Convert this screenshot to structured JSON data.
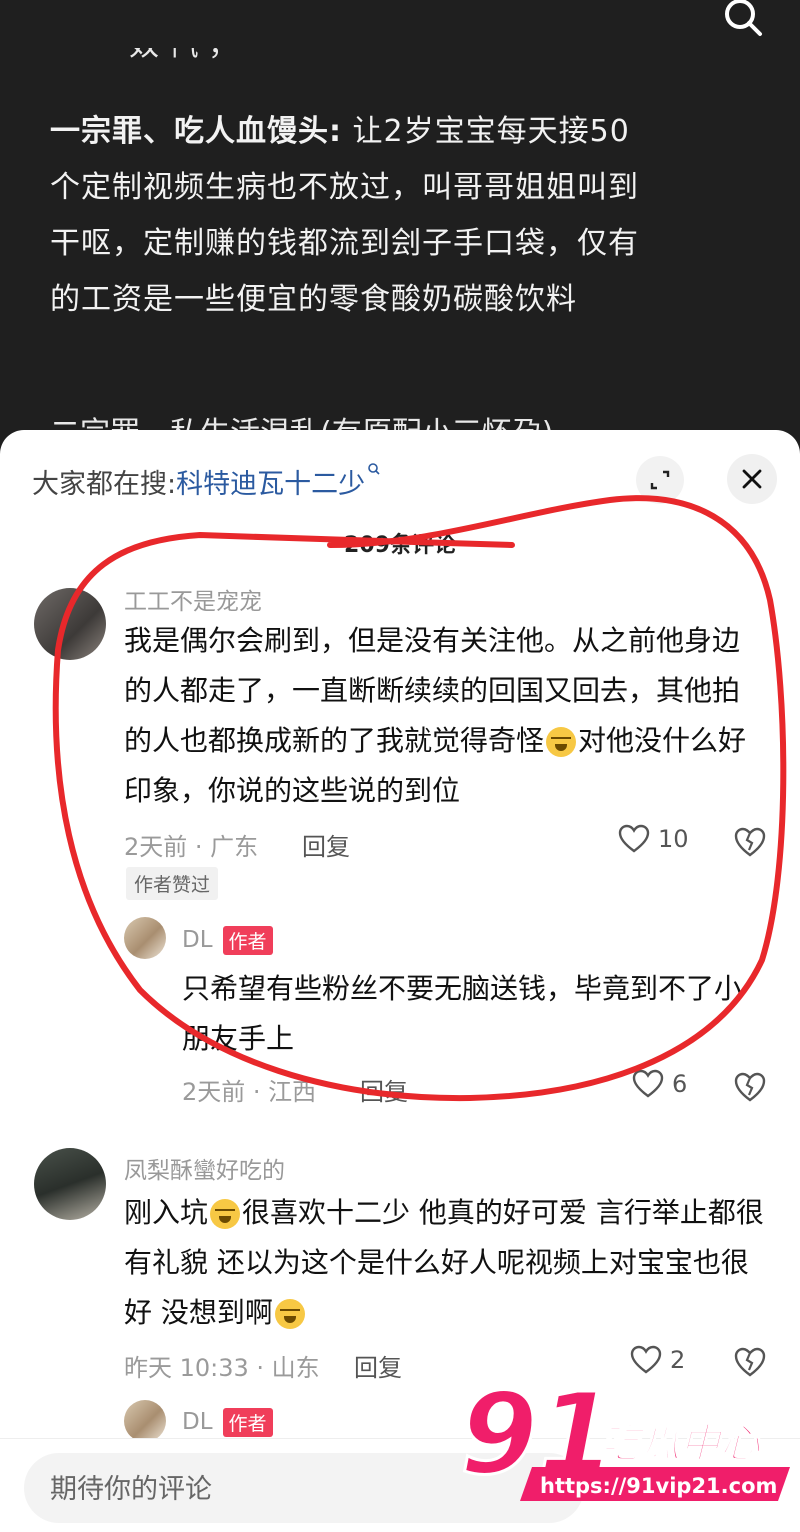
{
  "post": {
    "cut_line_top": "一 一 奴 忾 ，",
    "paragraph_title": "一宗罪、吃人血馒头:",
    "paragraph_body": " 让2岁宝宝每天接50个定制视频生病也不放过，叫哥哥姐姐叫到干呕，定制赚的钱都流到刽子手口袋，仅有的工资是一些便宜的零食酸奶碳酸饮料",
    "cut_line_bottom": "二宗罪、私生活混乱(有原配小三怀孕)"
  },
  "header": {
    "hot_search_label": "大家都在搜:",
    "hot_search_keyword": "科特迪瓦十二少",
    "comment_count": "209条评论"
  },
  "comments": [
    {
      "username": "工工不是宠宠",
      "text_a": "我是偶尔会刷到，但是没有关注他。从之前他身边的人都走了，一直断断续续的回国又回去，其他拍的人也都换成新的了我就觉得奇怪",
      "text_b": "对他没什么好印象，你说的这些说的到位",
      "time_location": "2天前 · 广东",
      "reply_label": "回复",
      "likes": "10",
      "author_liked_tag": "作者赞过"
    },
    {
      "username": "DL",
      "badge": "作者",
      "text": "只希望有些粉丝不要无脑送钱，毕竟到不了小朋友手上",
      "time_location": "2天前 · 江西",
      "reply_label": "回复",
      "likes": "6"
    },
    {
      "username": "凤梨酥蠻好吃的",
      "text_a": "刚入坑",
      "text_b": "很喜欢十二少 他真的好可爱 言行举止都很有礼貌 还以为这个是什么好人呢视频上对宝宝也很好 没想到啊",
      "time_location": "昨天 10:33 · 山东",
      "reply_label": "回复",
      "likes": "2"
    },
    {
      "username": "DL",
      "badge": "作者"
    }
  ],
  "input": {
    "placeholder": "期待你的评论"
  },
  "watermark": {
    "number": "91",
    "brand": "吃瓜中心",
    "url": "https://91vip21.com"
  },
  "icons": {
    "search": "search-icon",
    "expand": "expand-icon",
    "close": "close-icon",
    "heart": "heart-icon",
    "dislike": "broken-heart-icon",
    "emoji": "crying-laughing-emoji"
  },
  "colors": {
    "author_badge": "#f03e5a",
    "annotation_circle": "#e8282b",
    "keyword_link": "#2b5aa0"
  }
}
